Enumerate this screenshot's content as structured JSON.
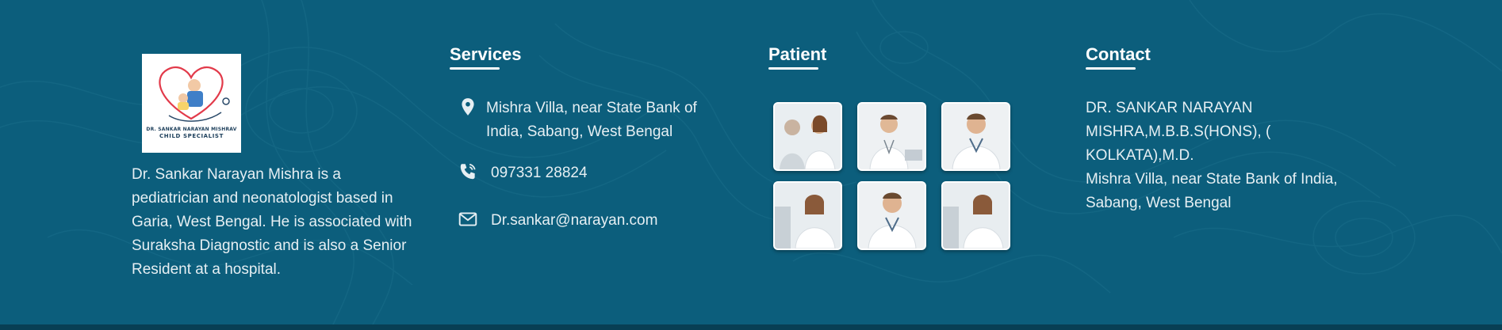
{
  "about": {
    "logo": {
      "line1": "DR. SANKAR NARAYAN MISHRAV",
      "line2": "CHILD SPECIALIST"
    },
    "description": "Dr. Sankar Narayan Mishra is a pediatrician and neonatologist based in Garia, West Bengal. He is associated with Suraksha Diagnostic and is also a Senior Resident at a hospital."
  },
  "services": {
    "heading": "Services",
    "address": "Mishra Villa, near State Bank of India, Sabang, West Bengal",
    "phone": "097331 28824",
    "email": "Dr.sankar@narayan.com",
    "icons": [
      "location-pin-icon",
      "phone-icon",
      "envelope-icon"
    ]
  },
  "patient": {
    "heading": "Patient",
    "thumbnails": [
      {
        "alt": "doctor-with-patient"
      },
      {
        "alt": "doctor-at-desk"
      },
      {
        "alt": "doctor-portrait"
      },
      {
        "alt": "female-doctor"
      },
      {
        "alt": "doctor-portrait"
      },
      {
        "alt": "female-doctor"
      }
    ]
  },
  "contact": {
    "heading": "Contact",
    "name_line1": "DR. SANKAR NARAYAN",
    "name_line2": "MISHRA,M.B.B.S(HONS), (",
    "name_line3": "KOLKATA),M.D.",
    "address_line1": "Mishra Villa, near State Bank of India,",
    "address_line2": "Sabang, West Bengal"
  },
  "colors": {
    "background": "#0c5e7c",
    "bottom_bar": "#083f54",
    "text": "#e6eff3",
    "heading": "#ffffff"
  }
}
